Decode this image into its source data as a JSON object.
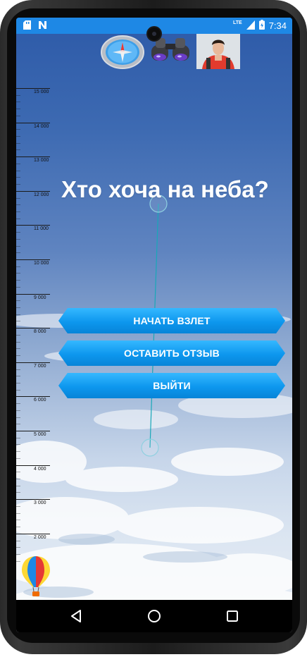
{
  "status_bar": {
    "network_label": "LTE",
    "time": "7:34",
    "left_icons": [
      "sd-card-icon",
      "notification-n-icon"
    ],
    "right_icons": [
      "signal-icon",
      "battery-icon"
    ]
  },
  "top_icons": [
    "compass-icon",
    "binoculars-icon",
    "traveler-avatar-icon"
  ],
  "altitude_ruler": {
    "labels": [
      "15 000",
      "14 000",
      "13 000",
      "12 000",
      "11 000",
      "10 000",
      "9 000",
      "8 000",
      "7 000",
      "6 000",
      "5 000",
      "4 000",
      "3 000",
      "2 000"
    ]
  },
  "title": "Хто хоча на неба?",
  "menu": {
    "start_label": "НАЧАТЬ ВЗЛЕТ",
    "review_label": "ОСТАВИТЬ ОТЗЫВ",
    "exit_label": "ВЫЙТИ"
  },
  "nav": [
    "back-icon",
    "home-icon",
    "recents-icon"
  ],
  "colors": {
    "status_bar": "#1e88e5",
    "button": "#0d97ee",
    "title_text": "#ffffff"
  }
}
